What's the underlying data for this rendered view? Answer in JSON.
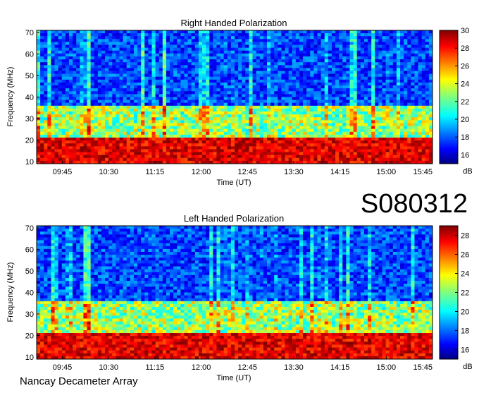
{
  "figure": {
    "id_label": "S080312",
    "footer": "Nancay Decameter Array"
  },
  "colors": {
    "scale": [
      "#00007f",
      "#0000ff",
      "#007fff",
      "#00ffff",
      "#7fff7f",
      "#ffff00",
      "#ff7f00",
      "#ff0000",
      "#7f0000"
    ]
  },
  "chart_data": [
    {
      "type": "heatmap",
      "title": "Right Handed Polarization",
      "xlabel": "Time (UT)",
      "ylabel": "Frequency (MHz)",
      "x_ticks": [
        "09:45",
        "10:30",
        "11:15",
        "12:00",
        "12:45",
        "13:30",
        "14:15",
        "15:00",
        "15:45"
      ],
      "x_range": [
        "09:20",
        "15:45"
      ],
      "y_ticks": [
        10,
        20,
        30,
        40,
        50,
        60,
        70
      ],
      "ylim": [
        9,
        71
      ],
      "colorbar": {
        "label": "dB",
        "ticks": [
          16,
          18,
          20,
          22,
          24,
          26,
          28,
          30
        ],
        "range": [
          15,
          30
        ]
      },
      "features": {
        "intense_band_mhz": [
          9,
          21
        ],
        "secondary_band_mhz": [
          22,
          36
        ]
      }
    },
    {
      "type": "heatmap",
      "title": "Left Handed Polarization",
      "xlabel": "Time (UT)",
      "ylabel": "Frequency (MHz)",
      "x_ticks": [
        "09:45",
        "10:30",
        "11:15",
        "12:00",
        "12:45",
        "13:30",
        "14:15",
        "15:00",
        "15:45"
      ],
      "x_range": [
        "09:20",
        "15:45"
      ],
      "y_ticks": [
        10,
        20,
        30,
        40,
        50,
        60,
        70
      ],
      "ylim": [
        9,
        71
      ],
      "colorbar": {
        "label": "dB",
        "ticks": [
          16,
          18,
          20,
          22,
          24,
          26,
          28
        ],
        "range": [
          15,
          29
        ]
      },
      "features": {
        "intense_band_mhz": [
          9,
          21
        ],
        "secondary_band_mhz": [
          22,
          36
        ]
      }
    }
  ]
}
